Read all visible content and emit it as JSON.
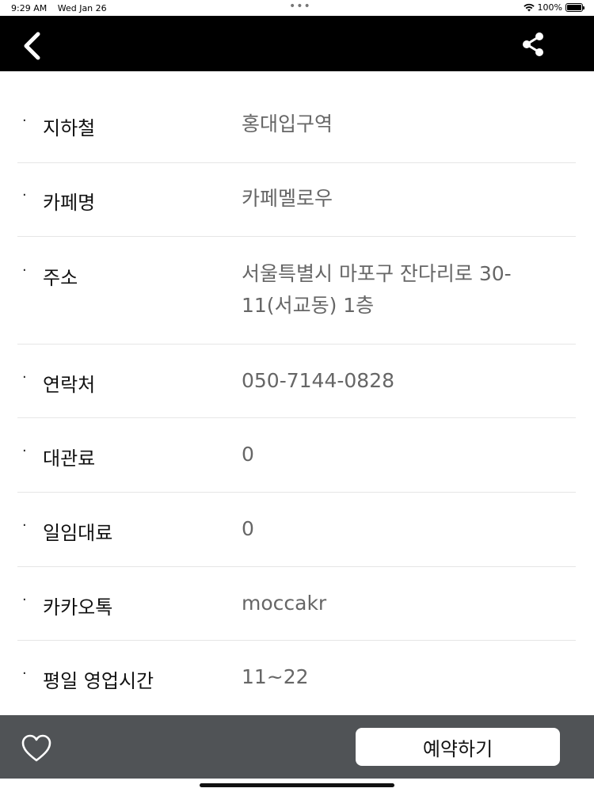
{
  "status_bar": {
    "time": "9:29 AM",
    "date": "Wed Jan 26",
    "battery_text": "100%",
    "icons": [
      "wifi-icon",
      "battery-icon"
    ]
  },
  "nav": {
    "back_icon": "chevron-left-icon",
    "share_icon": "share-icon",
    "background": "#000000"
  },
  "details": [
    {
      "label": "지하철",
      "value": "홍대입구역"
    },
    {
      "label": "카페명",
      "value": "카페멜로우"
    },
    {
      "label": "주소",
      "value": "서울특별시 마포구 잔다리로 30-11(서교동) 1층"
    },
    {
      "label": "연락처",
      "value": "050-7144-0828"
    },
    {
      "label": "대관료",
      "value": "0"
    },
    {
      "label": "일임대료",
      "value": "0"
    },
    {
      "label": "카카오톡",
      "value": "moccakr"
    },
    {
      "label": "평일 영업시간",
      "value": "11~22"
    }
  ],
  "bottom_bar": {
    "heart_icon": "heart-outline-icon",
    "reserve_label": "예약하기",
    "background": "#505356"
  }
}
